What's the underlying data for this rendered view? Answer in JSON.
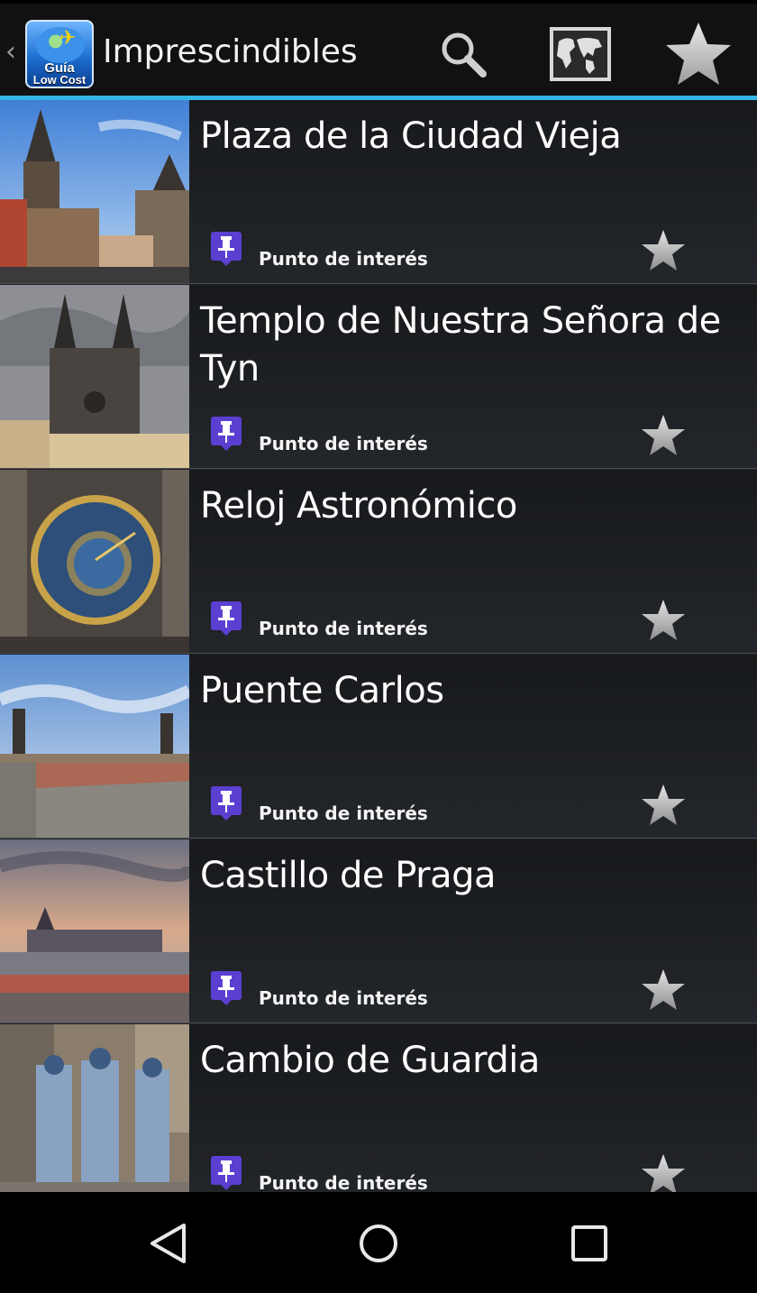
{
  "app": {
    "logo_text_line1": "Guía",
    "logo_text_line2": "Low Cost",
    "title": "Imprescindibles",
    "accent_color": "#33b5e5",
    "actions": [
      {
        "icon": "search-icon"
      },
      {
        "icon": "world-map-icon"
      },
      {
        "icon": "star-icon"
      }
    ]
  },
  "list": {
    "items": [
      {
        "title": "Plaza de la Ciudad Vieja",
        "category": "Punto de interés",
        "category_icon": "pin-icon",
        "favorite_icon": "star-icon"
      },
      {
        "title": "Templo de Nuestra Señora de Tyn",
        "category": "Punto de interés",
        "category_icon": "pin-icon",
        "favorite_icon": "star-icon"
      },
      {
        "title": "Reloj Astronómico",
        "category": "Punto de interés",
        "category_icon": "pin-icon",
        "favorite_icon": "star-icon"
      },
      {
        "title": "Puente Carlos",
        "category": "Punto de interés",
        "category_icon": "pin-icon",
        "favorite_icon": "star-icon"
      },
      {
        "title": "Castillo de Praga",
        "category": "Punto de interés",
        "category_icon": "pin-icon",
        "favorite_icon": "star-icon"
      },
      {
        "title": "Cambio de Guardia",
        "category": "Punto de interés",
        "category_icon": "pin-icon",
        "favorite_icon": "star-icon"
      }
    ]
  },
  "colors": {
    "pin": "#5b3fd1",
    "star": "#b9b9b9"
  },
  "navbar": {
    "buttons": [
      "back-icon",
      "home-icon",
      "recents-icon"
    ]
  }
}
